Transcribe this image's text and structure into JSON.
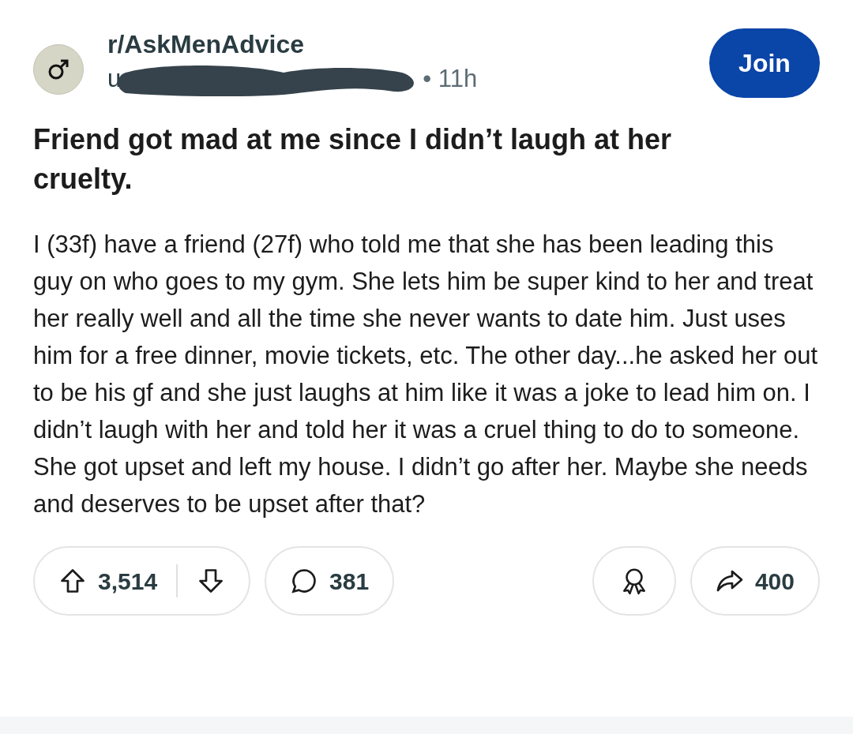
{
  "post": {
    "subreddit": "r/AskMenAdvice",
    "username": "u",
    "age": "• 11h",
    "join_label": "Join",
    "title": "Friend got mad at me since I didn’t laugh at her cruelty.",
    "body": "I (33f) have a friend (27f) who told me that she has been leading this guy on who goes to my gym. She lets him be super kind to her and treat her really well and all the time she never wants to date him. Just uses him for a free dinner, movie tickets, etc. The other day...he asked her out to be his gf and she just laughs at him like it was a joke to lead him on. I didn’t laugh with her and told her it was a cruel thing to do to someone. She got upset and left my house. I didn’t go after her. Maybe she needs and deserves to be upset after that?"
  },
  "actions": {
    "votes": "3,514",
    "comments": "381",
    "shares": "400"
  }
}
